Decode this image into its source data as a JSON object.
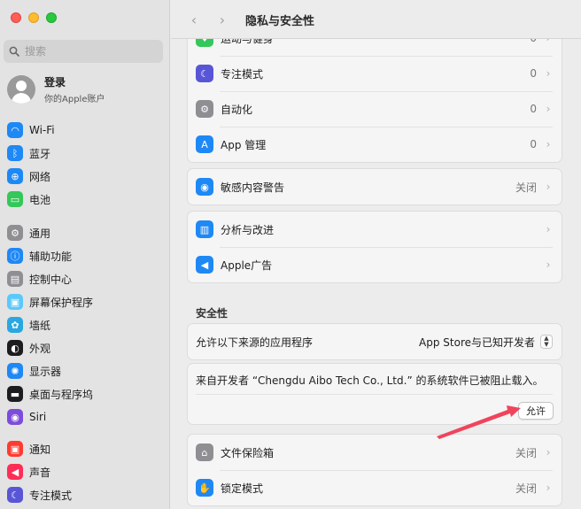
{
  "window": {
    "title": "隐私与安全性"
  },
  "sidebar": {
    "search_placeholder": "搜索",
    "account": {
      "name": "登录",
      "subtitle": "你的Apple账户"
    },
    "group1": [
      {
        "label": "Wi-Fi",
        "icon": "wifi-icon",
        "color": "#1e88f5"
      },
      {
        "label": "蓝牙",
        "icon": "bluetooth-icon",
        "color": "#1e88f5"
      },
      {
        "label": "网络",
        "icon": "globe-icon",
        "color": "#1e88f5"
      },
      {
        "label": "电池",
        "icon": "battery-icon",
        "color": "#34c759"
      }
    ],
    "group2": [
      {
        "label": "通用",
        "icon": "gear-icon",
        "color": "#8e8e93"
      },
      {
        "label": "辅助功能",
        "icon": "accessibility-icon",
        "color": "#1e88f5"
      },
      {
        "label": "控制中心",
        "icon": "control-center-icon",
        "color": "#8e8e93"
      },
      {
        "label": "屏幕保护程序",
        "icon": "screensaver-icon",
        "color": "#5ac8fa"
      },
      {
        "label": "墙纸",
        "icon": "wallpaper-icon",
        "color": "#2aa7e0"
      },
      {
        "label": "外观",
        "icon": "appearance-icon",
        "color": "#1c1c1e"
      },
      {
        "label": "显示器",
        "icon": "display-icon",
        "color": "#1e88f5"
      },
      {
        "label": "桌面与程序坞",
        "icon": "dock-icon",
        "color": "#1c1c1e"
      },
      {
        "label": "Siri",
        "icon": "siri-icon",
        "color": "#7d4cdb"
      }
    ],
    "group3": [
      {
        "label": "通知",
        "icon": "bell-icon",
        "color": "#ff3b30"
      },
      {
        "label": "声音",
        "icon": "speaker-icon",
        "color": "#ff2d55"
      },
      {
        "label": "专注模式",
        "icon": "moon-icon",
        "color": "#5856d6"
      }
    ]
  },
  "main": {
    "group_top": [
      {
        "label": "运动与健身",
        "value": "0",
        "icon": "fitness-icon",
        "color": "#34c759"
      },
      {
        "label": "专注模式",
        "value": "0",
        "icon": "moon-icon",
        "color": "#5856d6"
      },
      {
        "label": "自动化",
        "value": "0",
        "icon": "automation-icon",
        "color": "#8e8e93"
      },
      {
        "label": "App 管理",
        "value": "0",
        "icon": "app-store-icon",
        "color": "#1e88f5"
      }
    ],
    "sensitive": {
      "label": "敏感内容警告",
      "value": "关闭",
      "icon": "eye-icon",
      "color": "#1e88f5"
    },
    "analytics": [
      {
        "label": "分析与改进",
        "value": "",
        "icon": "chart-icon",
        "color": "#1e88f5"
      },
      {
        "label": "Apple广告",
        "value": "",
        "icon": "megaphone-icon",
        "color": "#1e88f5"
      }
    ],
    "security": {
      "title": "安全性",
      "allow_label": "允许以下来源的应用程序",
      "allow_value": "App Store与已知开发者"
    },
    "notice": {
      "text": "来自开发者 “Chengdu Aibo Tech Co., Ltd.” 的系统软件已被阻止载入。",
      "button": "允许"
    },
    "bottom": [
      {
        "label": "文件保险箱",
        "value": "关闭",
        "icon": "vault-icon",
        "color": "#8e8e93"
      },
      {
        "label": "锁定模式",
        "value": "关闭",
        "icon": "hand-icon",
        "color": "#1e88f5"
      }
    ],
    "arrow_color": "#f0445c"
  }
}
